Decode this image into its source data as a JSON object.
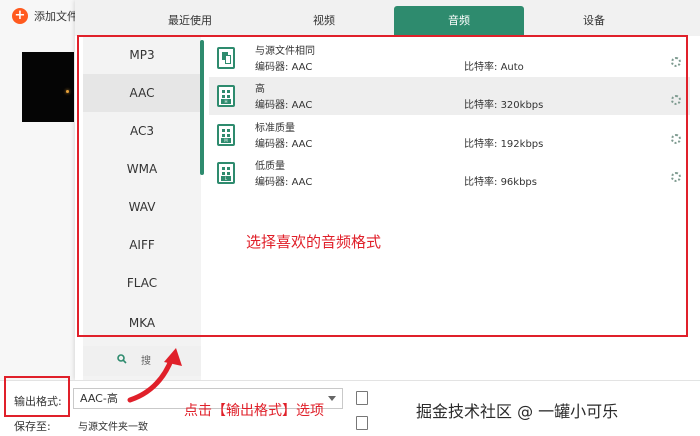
{
  "app": {
    "add_file_label": "添加文件",
    "output_format_label": "输出格式:",
    "output_format_value": "AAC-高",
    "save_to_label": "保存至:",
    "save_to_value": "与源文件夹一致"
  },
  "dialog": {
    "tabs": [
      {
        "label": "最近使用",
        "active": false
      },
      {
        "label": "视频",
        "active": false
      },
      {
        "label": "音频",
        "active": true
      },
      {
        "label": "设备",
        "active": false
      }
    ],
    "formats": [
      "MP3",
      "AAC",
      "AC3",
      "WMA",
      "WAV",
      "AIFF",
      "FLAC",
      "MKA"
    ],
    "selected_format": "AAC",
    "search_text": "搜",
    "presets": [
      {
        "name": "与源文件相同",
        "encoder_label": "编码器:",
        "encoder": "AAC",
        "bitrate_label": "比特率:",
        "bitrate": "Auto",
        "icon": "copy-icon"
      },
      {
        "name": "高",
        "encoder_label": "编码器:",
        "encoder": "AAC",
        "bitrate_label": "比特率:",
        "bitrate": "320kbps",
        "icon": "quality-high-icon"
      },
      {
        "name": "标准质量",
        "encoder_label": "编码器:",
        "encoder": "AAC",
        "bitrate_label": "比特率:",
        "bitrate": "192kbps",
        "icon": "quality-mid-icon"
      },
      {
        "name": "低质量",
        "encoder_label": "编码器:",
        "encoder": "AAC",
        "bitrate_label": "比特率:",
        "bitrate": "96kbps",
        "icon": "quality-low-icon"
      }
    ],
    "selected_preset": "高"
  },
  "annotations": {
    "hint_presets": "选择喜欢的音频格式",
    "hint_output": "点击【输出格式】选项",
    "watermark": "掘金技术社区 @ 一罐小可乐"
  },
  "colors": {
    "accent": "#2e8b6e",
    "highlight_red": "#e0202a",
    "add_button": "#ff5a1f"
  }
}
